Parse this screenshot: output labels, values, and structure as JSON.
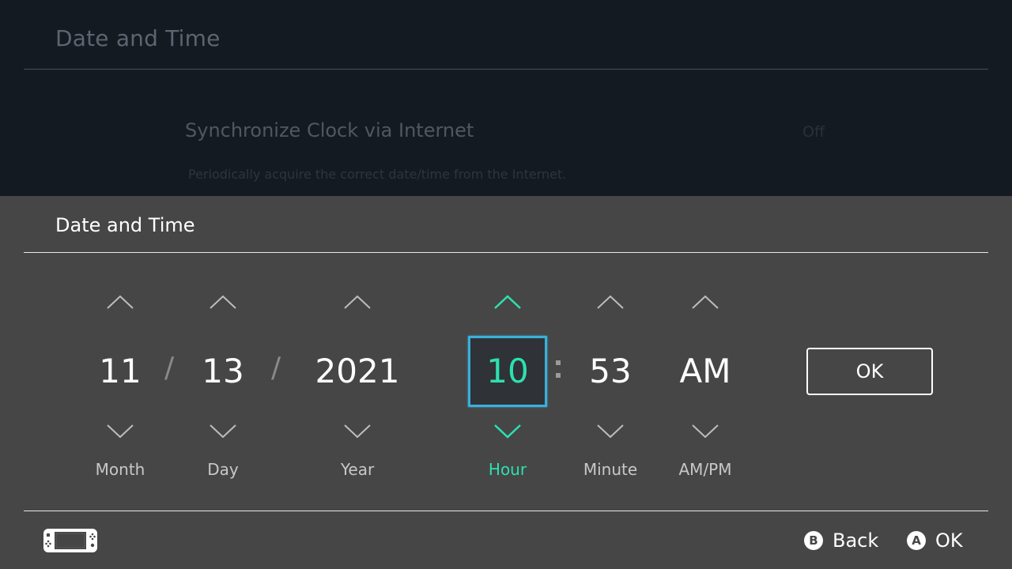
{
  "background": {
    "title": "Date and Time",
    "setting": {
      "label": "Synchronize Clock via Internet",
      "value": "Off",
      "description": "Periodically acquire the correct date/time from the Internet."
    }
  },
  "dialog": {
    "title": "Date and Time",
    "separators": {
      "date": "/",
      "time": ":"
    },
    "fields": [
      {
        "name": "month",
        "value": "11",
        "label": "Month",
        "active": false
      },
      {
        "name": "day",
        "value": "13",
        "label": "Day",
        "active": false
      },
      {
        "name": "year",
        "value": "2021",
        "label": "Year",
        "active": false
      },
      {
        "name": "hour",
        "value": "10",
        "label": "Hour",
        "active": true
      },
      {
        "name": "minute",
        "value": "53",
        "label": "Minute",
        "active": false
      },
      {
        "name": "ampm",
        "value": "AM",
        "label": "AM/PM",
        "active": false
      }
    ],
    "ok_label": "OK"
  },
  "footer": {
    "console_icon": "handheld-console-icon",
    "buttons": [
      {
        "glyph": "B",
        "label": "Back"
      },
      {
        "glyph": "A",
        "label": "OK"
      }
    ]
  },
  "colors": {
    "background": "#131a22",
    "panel": "#464646",
    "accent": "#2de0b0",
    "focus_border": "#3ab0d8"
  }
}
